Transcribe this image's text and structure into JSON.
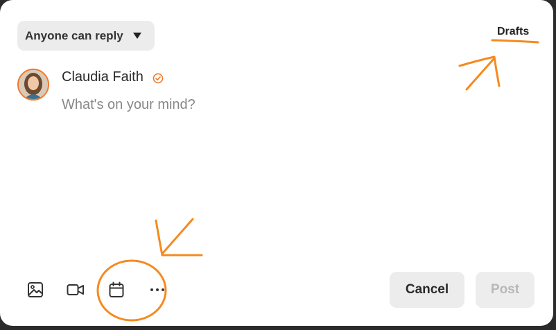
{
  "composer": {
    "reply_setting": "Anyone can reply",
    "drafts_label": "Drafts",
    "user_name": "Claudia Faith",
    "placeholder": "What's on your mind?",
    "text": ""
  },
  "toolbar": {
    "tools": [
      {
        "icon": "image-icon"
      },
      {
        "icon": "video-camera-icon"
      },
      {
        "icon": "calendar-icon"
      },
      {
        "icon": "more-dots-icon"
      }
    ],
    "cancel_label": "Cancel",
    "post_label": "Post"
  },
  "colors": {
    "accent": "#f2782a",
    "annotation": "#f58a1f",
    "button_bg": "#ececec",
    "post_disabled_text": "#b8b8b8"
  }
}
